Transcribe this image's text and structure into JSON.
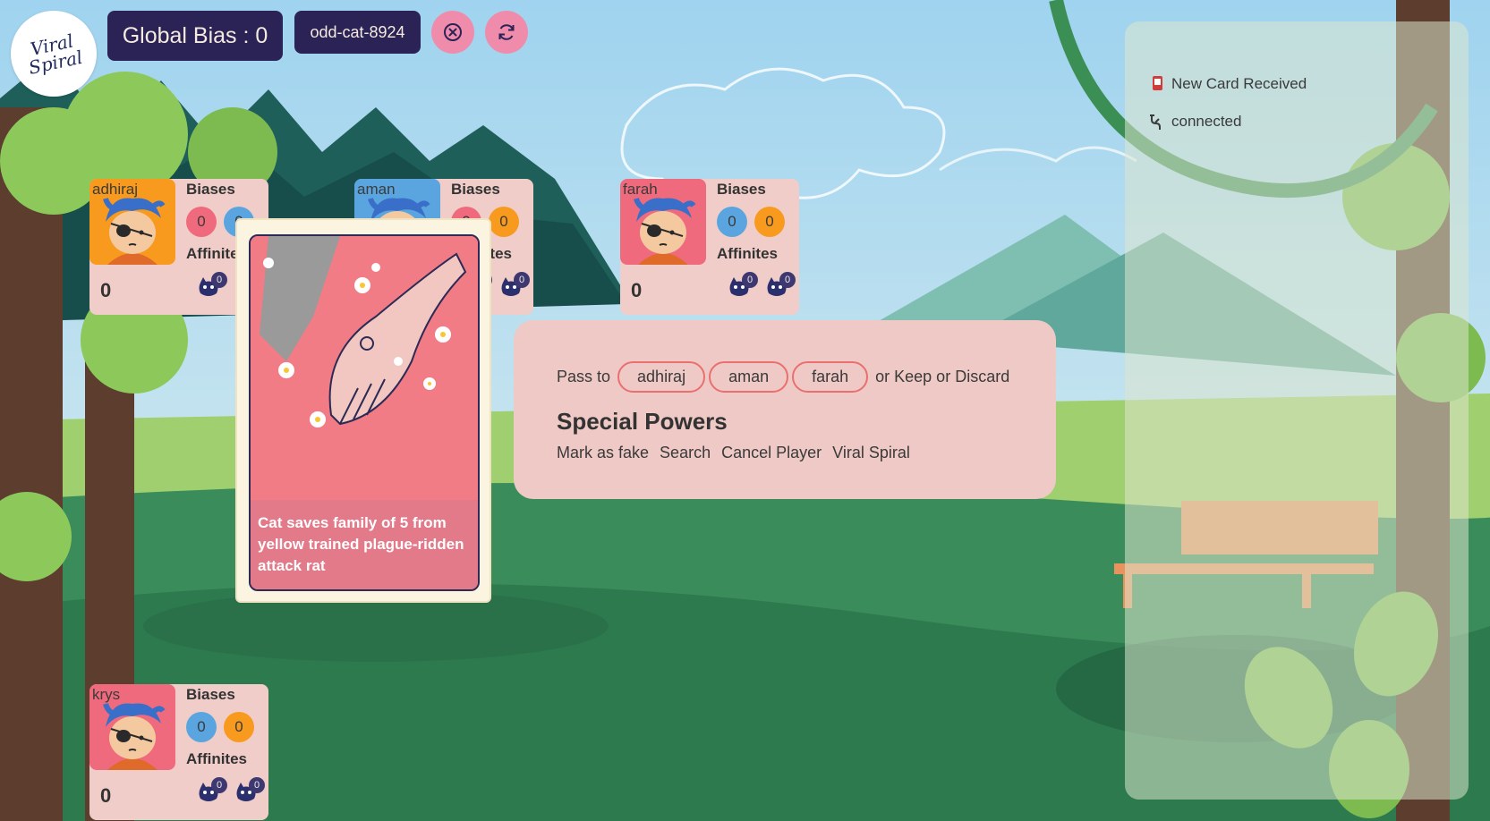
{
  "header": {
    "logo_text": "Viral Spiral",
    "global_bias_label": "Global Bias : 0",
    "room_name": "odd-cat-8924"
  },
  "players": [
    {
      "name": "adhiraj",
      "avatar_bg": "#f79a1e",
      "biases_label": "Biases",
      "affinities_label": "Affinites",
      "bias_values": [
        "0",
        "0"
      ],
      "bias_colors": [
        "#f06a7d",
        "#5aa5df"
      ],
      "score": "0",
      "affinity_values": [
        "0",
        "0"
      ]
    },
    {
      "name": "aman",
      "avatar_bg": "#5aa5df",
      "biases_label": "Biases",
      "affinities_label": "Affinites",
      "bias_values": [
        "0",
        "0"
      ],
      "bias_colors": [
        "#f06a7d",
        "#f79a1e"
      ],
      "score": "0",
      "affinity_values": [
        "0",
        "0"
      ]
    },
    {
      "name": "farah",
      "avatar_bg": "#f06a7d",
      "biases_label": "Biases",
      "affinities_label": "Affinites",
      "bias_values": [
        "0",
        "0"
      ],
      "bias_colors": [
        "#5aa5df",
        "#f79a1e"
      ],
      "score": "0",
      "affinity_values": [
        "0",
        "0"
      ]
    },
    {
      "name": "krys",
      "avatar_bg": "#f06a7d",
      "biases_label": "Biases",
      "affinities_label": "Affinites",
      "bias_values": [
        "0",
        "0"
      ],
      "bias_colors": [
        "#5aa5df",
        "#f79a1e"
      ],
      "score": "0",
      "affinity_values": [
        "0",
        "0"
      ]
    }
  ],
  "card": {
    "caption": "Cat saves family of 5 from yellow trained plague-ridden attack rat"
  },
  "actions": {
    "pass_to_label": "Pass to",
    "pass_targets": [
      "adhiraj",
      "aman",
      "farah"
    ],
    "keep_discard_label": "or Keep or Discard",
    "special_powers_title": "Special Powers",
    "special_powers": [
      "Mark as fake",
      "Search",
      "Cancel Player",
      "Viral Spiral"
    ]
  },
  "log": {
    "new_card": "New Card Received",
    "connection": "connected"
  },
  "colors": {
    "header_bg": "#2b2256",
    "button_pink": "#f08cab",
    "player_card_bg": "#f0cdc8",
    "action_panel_bg": "#efc9c5",
    "pass_border": "#ea6f6f",
    "card_red": "#f17c85"
  },
  "icons": {
    "close": "close-circle-icon",
    "refresh": "refresh-icon",
    "affinity": "cat-affinity-icon",
    "new_card": "card-icon",
    "connection": "plug-icon"
  }
}
